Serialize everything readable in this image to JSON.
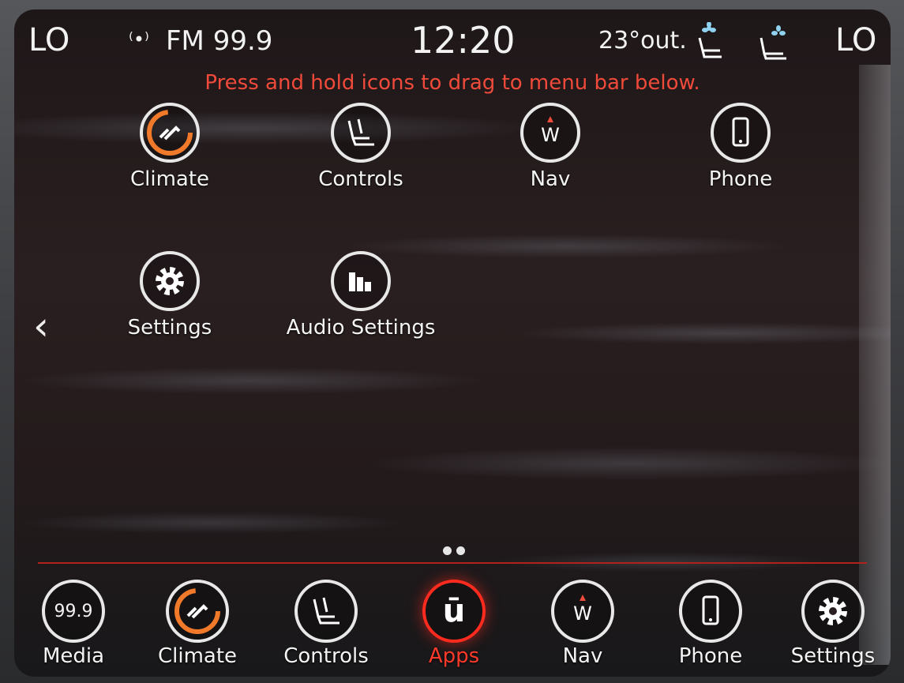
{
  "status": {
    "temp_left": "LO",
    "temp_right": "LO",
    "radio_label": "FM 99.9",
    "radio_icon": "antenna-icon",
    "clock": "12:20",
    "outside_temp": "23°out.",
    "icons": [
      "heated-seat-fan-icon",
      "seat-ventilation-icon"
    ]
  },
  "hint": "Press and hold icons to drag to menu bar below.",
  "apps": [
    {
      "label": "Climate",
      "icon": "climate-icon"
    },
    {
      "label": "Controls",
      "icon": "controls-seat-icon"
    },
    {
      "label": "Nav",
      "icon": "compass-icon"
    },
    {
      "label": "Phone",
      "icon": "phone-icon"
    },
    {
      "label": "Settings",
      "icon": "gear-icon"
    },
    {
      "label": "Audio Settings",
      "icon": "equalizer-icon"
    }
  ],
  "nav_icon_letter": "W",
  "page_indicator": {
    "pages": 2
  },
  "menu_bar": [
    {
      "label": "Media",
      "icon_text": "99.9"
    },
    {
      "label": "Climate",
      "icon": "climate-icon"
    },
    {
      "label": "Controls",
      "icon": "controls-seat-icon"
    },
    {
      "label": "Apps",
      "icon": "uconnect-icon",
      "icon_text": "ū",
      "active": true
    },
    {
      "label": "Nav",
      "icon": "compass-icon"
    },
    {
      "label": "Phone",
      "icon": "phone-icon"
    },
    {
      "label": "Settings",
      "icon": "gear-icon"
    }
  ],
  "colors": {
    "accent": "#f04a3a",
    "active": "#ff2b1f",
    "climate_arc": "#f07a2a"
  }
}
